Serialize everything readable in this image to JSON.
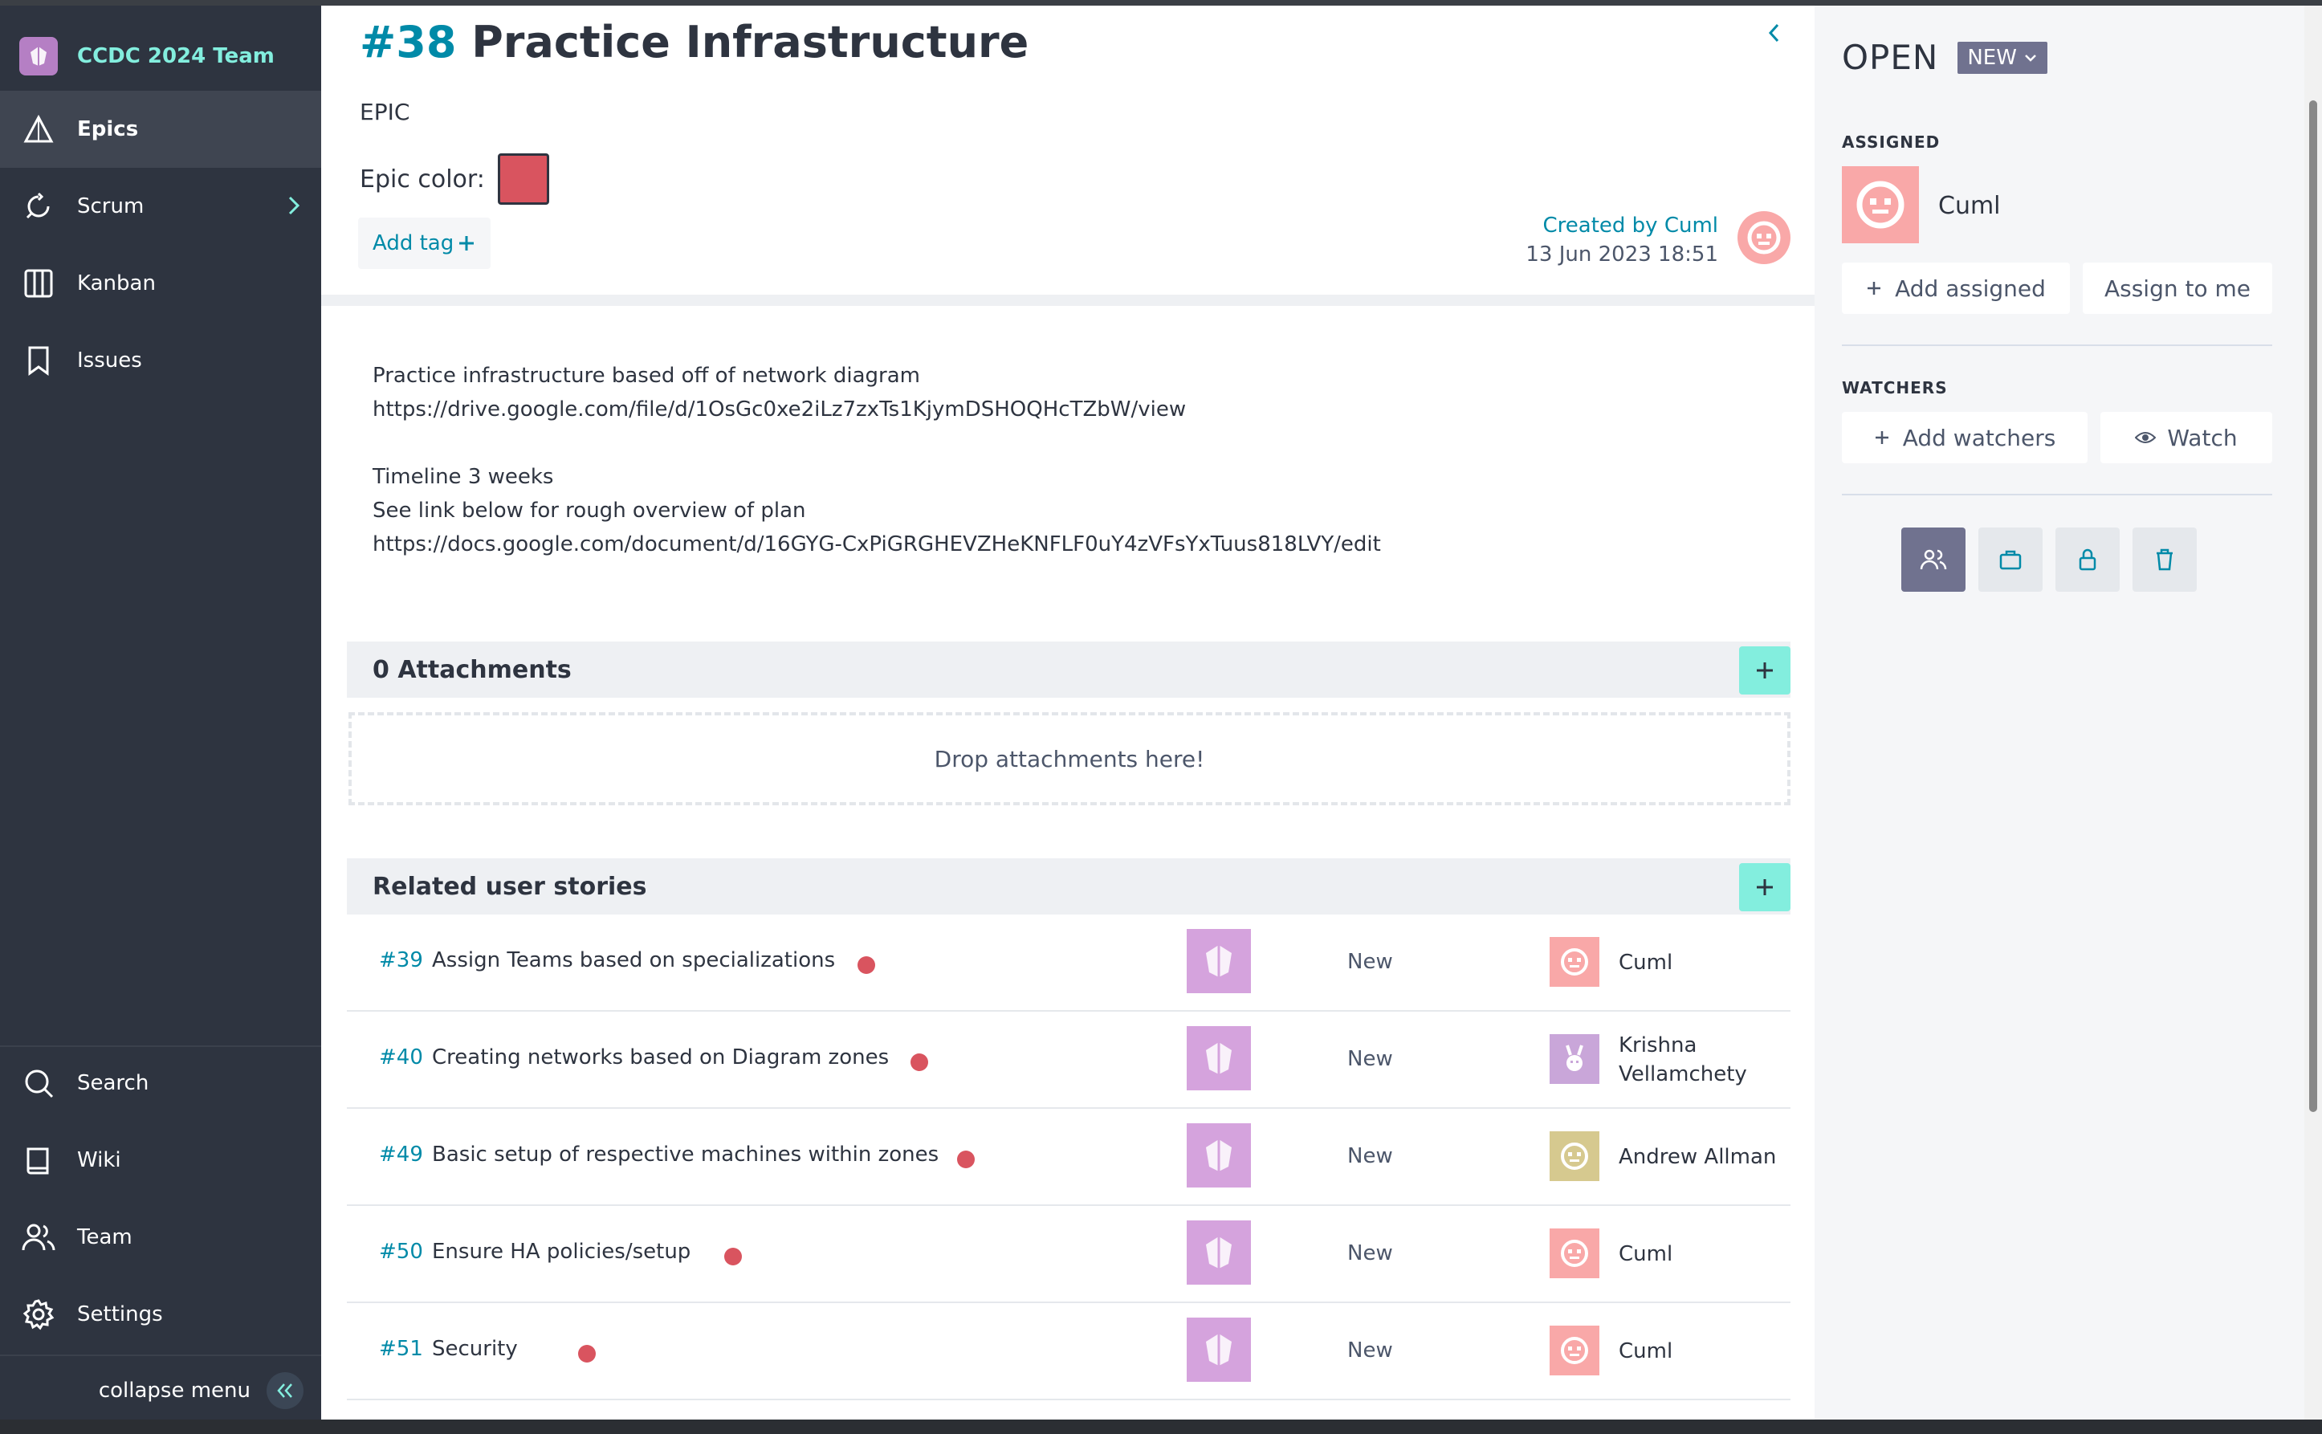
{
  "sidebar": {
    "project_name": "CCDC 2024 Team",
    "items": [
      {
        "label": "Epics"
      },
      {
        "label": "Scrum"
      },
      {
        "label": "Kanban"
      },
      {
        "label": "Issues"
      },
      {
        "label": "Search"
      },
      {
        "label": "Wiki"
      },
      {
        "label": "Team"
      },
      {
        "label": "Settings"
      }
    ],
    "collapse_label": "collapse menu"
  },
  "epic": {
    "ref": "#38",
    "title": "Practice Infrastructure",
    "type_label": "EPIC",
    "color_label": "Epic color:",
    "color": "#d9545f",
    "add_tag": "Add tag",
    "created_by": "Created by Cuml",
    "created_date": "13 Jun 2023 18:51",
    "description": "Practice infrastructure based off of network diagram\nhttps://drive.google.com/file/d/1OsGc0xe2iLz7zxTs1KjymDSHOQHcTZbW/view\n\nTimeline 3 weeks\nSee link below for rough overview of plan\nhttps://docs.google.com/document/d/16GYG-CxPiGRGHEVZHeKNFLF0uY4zVFsYxTuus818LVY/edit"
  },
  "attachments": {
    "header": "0 Attachments",
    "drop_text": "Drop attachments here!"
  },
  "related": {
    "header": "Related user stories",
    "stories": [
      {
        "ref": "#39",
        "subject": "Assign Teams based on specializations",
        "status": "New",
        "assignee": "Cuml",
        "assignee2": ""
      },
      {
        "ref": "#40",
        "subject": "Creating networks based on Diagram zones",
        "status": "New",
        "assignee": "Krishna",
        "assignee2": "Vellamchety"
      },
      {
        "ref": "#49",
        "subject": "Basic setup of respective machines within zones",
        "status": "New",
        "assignee": "Andrew Allman",
        "assignee2": ""
      },
      {
        "ref": "#50",
        "subject": "Ensure HA policies/setup",
        "status": "New",
        "assignee": "Cuml",
        "assignee2": ""
      },
      {
        "ref": "#51",
        "subject": "Security",
        "status": "New",
        "assignee": "Cuml",
        "assignee2": ""
      }
    ]
  },
  "panel": {
    "status": "OPEN",
    "status_badge": "NEW",
    "assigned_label": "ASSIGNED",
    "assigned_name": "Cuml",
    "add_assigned": "Add assigned",
    "assign_to_me": "Assign to me",
    "watchers_label": "WATCHERS",
    "add_watchers": "Add watchers",
    "watch": "Watch"
  },
  "colors": {
    "accent": "#008aa8",
    "brand_teal": "#83eede",
    "sidebar_bg": "#2e3440",
    "epic_red": "#d9545f",
    "badge": "#70728f"
  }
}
